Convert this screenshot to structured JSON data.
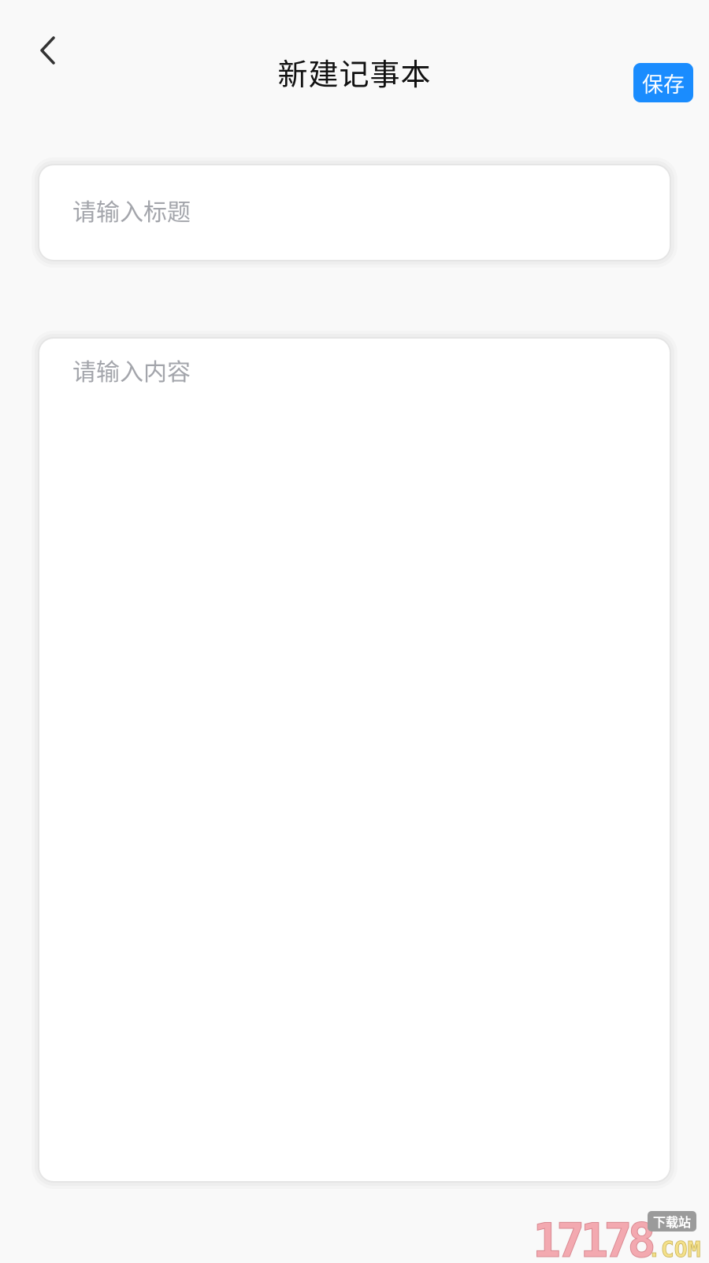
{
  "header": {
    "back_icon": "chevron-left-icon",
    "title": "新建记事本",
    "save_label": "保存"
  },
  "form": {
    "title_placeholder": "请输入标题",
    "title_value": "",
    "content_placeholder": "请输入内容",
    "content_value": ""
  },
  "watermark": {
    "number": "17178",
    "badge": "下载站",
    "suffix": ".COM"
  },
  "colors": {
    "accent": "#1a8cfe",
    "background": "#f9f9f9",
    "placeholder": "#a3a5ab",
    "title_text": "#111111"
  }
}
